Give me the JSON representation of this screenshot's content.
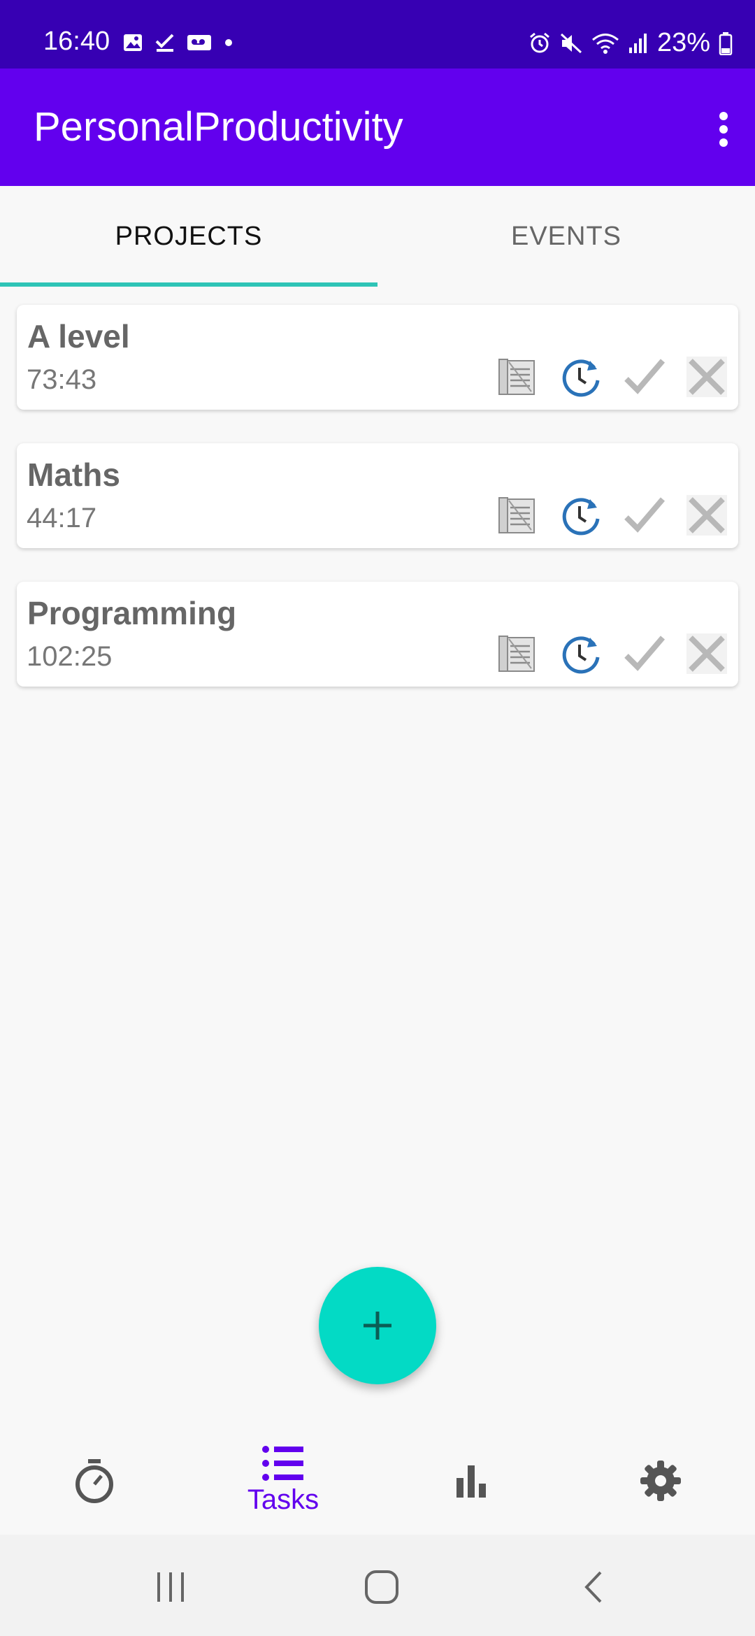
{
  "status_bar": {
    "time": "16:40",
    "battery_text": "23%",
    "left_icons": [
      "image-icon",
      "check-icon",
      "voicemail-icon",
      "dot-icon"
    ],
    "right_icons": [
      "alarm-icon",
      "mute-icon",
      "wifi-icon",
      "signal-icon",
      "battery-icon"
    ]
  },
  "app_bar": {
    "title": "PersonalProductivity",
    "menu_icon": "more-vert-icon"
  },
  "tabs": [
    {
      "label": "PROJECTS",
      "active": true
    },
    {
      "label": "EVENTS",
      "active": false
    }
  ],
  "colors": {
    "status_bar": "#3700b3",
    "app_bar": "#6200ee",
    "tab_indicator": "#2ec4b6",
    "fab": "#03dac5",
    "nav_active": "#6200ee"
  },
  "projects": [
    {
      "name": "A level",
      "time": "73:43"
    },
    {
      "name": "Maths",
      "time": "44:17"
    },
    {
      "name": "Programming",
      "time": "102:25"
    }
  ],
  "card_actions": [
    "notes-icon",
    "clock-restart-icon",
    "check-icon",
    "close-icon"
  ],
  "fab": {
    "icon": "plus-icon"
  },
  "bottom_nav": [
    {
      "icon": "timer-icon",
      "label": "",
      "active": false
    },
    {
      "icon": "list-icon",
      "label": "Tasks",
      "active": true
    },
    {
      "icon": "bar-chart-icon",
      "label": "",
      "active": false
    },
    {
      "icon": "gear-icon",
      "label": "",
      "active": false
    }
  ],
  "system_nav": [
    "recents-icon",
    "home-icon",
    "back-icon"
  ]
}
